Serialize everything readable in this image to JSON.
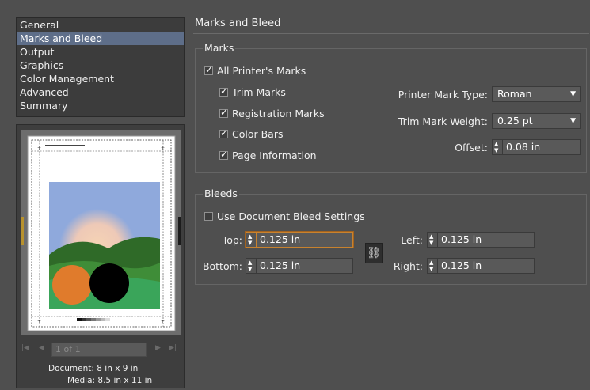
{
  "nav": {
    "items": [
      {
        "label": "General",
        "selected": false
      },
      {
        "label": "Marks and Bleed",
        "selected": true
      },
      {
        "label": "Output",
        "selected": false
      },
      {
        "label": "Graphics",
        "selected": false
      },
      {
        "label": "Color Management",
        "selected": false
      },
      {
        "label": "Advanced",
        "selected": false
      },
      {
        "label": "Summary",
        "selected": false
      }
    ]
  },
  "preview": {
    "pager_value": "1 of 1",
    "document": "Document: 8 in x 9 in",
    "media": "Media: 8.5 in x 11 in",
    "colors": {
      "sky": "#8fa9dc",
      "sun": "#f5d2b2",
      "hill_dark": "#2f6a28",
      "hill_mid": "#3f8d38",
      "grass": "#3aa55a",
      "orange": "#e07b2c",
      "black": "#000000"
    }
  },
  "panel": {
    "title": "Marks and Bleed",
    "marks": {
      "title": "Marks",
      "all_printers_marks": {
        "label": "All Printer's Marks",
        "checked": true
      },
      "trim_marks": {
        "label": "Trim Marks",
        "checked": true
      },
      "registration_marks": {
        "label": "Registration Marks",
        "checked": true
      },
      "color_bars": {
        "label": "Color Bars",
        "checked": true
      },
      "page_information": {
        "label": "Page Information",
        "checked": true
      },
      "printer_mark_type": {
        "label": "Printer Mark Type:",
        "value": "Roman"
      },
      "trim_mark_weight": {
        "label": "Trim Mark Weight:",
        "value": "0.25 pt"
      },
      "offset": {
        "label": "Offset:",
        "value": "0.08 in"
      }
    },
    "bleeds": {
      "title": "Bleeds",
      "use_document_bleed": {
        "label": "Use Document Bleed Settings",
        "checked": false
      },
      "top": {
        "label": "Top:",
        "value": "0.125 in"
      },
      "bottom": {
        "label": "Bottom:",
        "value": "0.125 in"
      },
      "left": {
        "label": "Left:",
        "value": "0.125 in"
      },
      "right": {
        "label": "Right:",
        "value": "0.125 in"
      }
    }
  }
}
